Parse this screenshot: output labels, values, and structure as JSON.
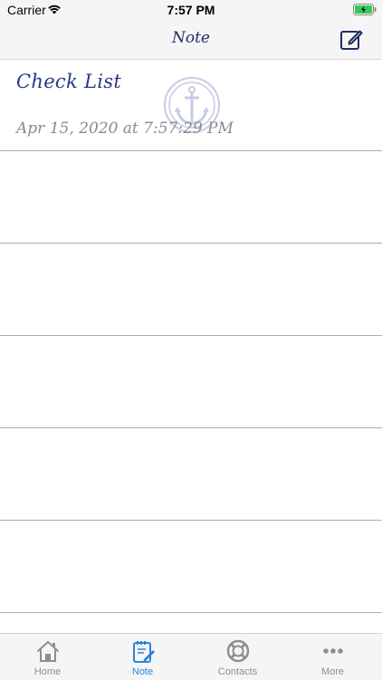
{
  "status_bar": {
    "carrier": "Carrier",
    "time": "7:57 PM",
    "wifi_icon": "wifi-icon",
    "battery_icon": "battery-charging-icon"
  },
  "nav": {
    "title": "Note",
    "compose_icon": "compose-icon"
  },
  "note": {
    "title": "Check List",
    "date": "Apr 15, 2020 at 7:57:29 PM",
    "watermark_icon": "anchor-icon"
  },
  "tab_bar": {
    "items": [
      {
        "label": "Home",
        "icon": "home-icon",
        "active": false
      },
      {
        "label": "Note",
        "icon": "notepad-icon",
        "active": true
      },
      {
        "label": "Contacts",
        "icon": "lifebuoy-icon",
        "active": false
      },
      {
        "label": "More",
        "icon": "more-icon",
        "active": false
      }
    ]
  },
  "colors": {
    "accent": "#2a86d6",
    "title_blue": "#26388a",
    "rule": "#a8aac4",
    "bar_background": "#f6f5f6"
  }
}
